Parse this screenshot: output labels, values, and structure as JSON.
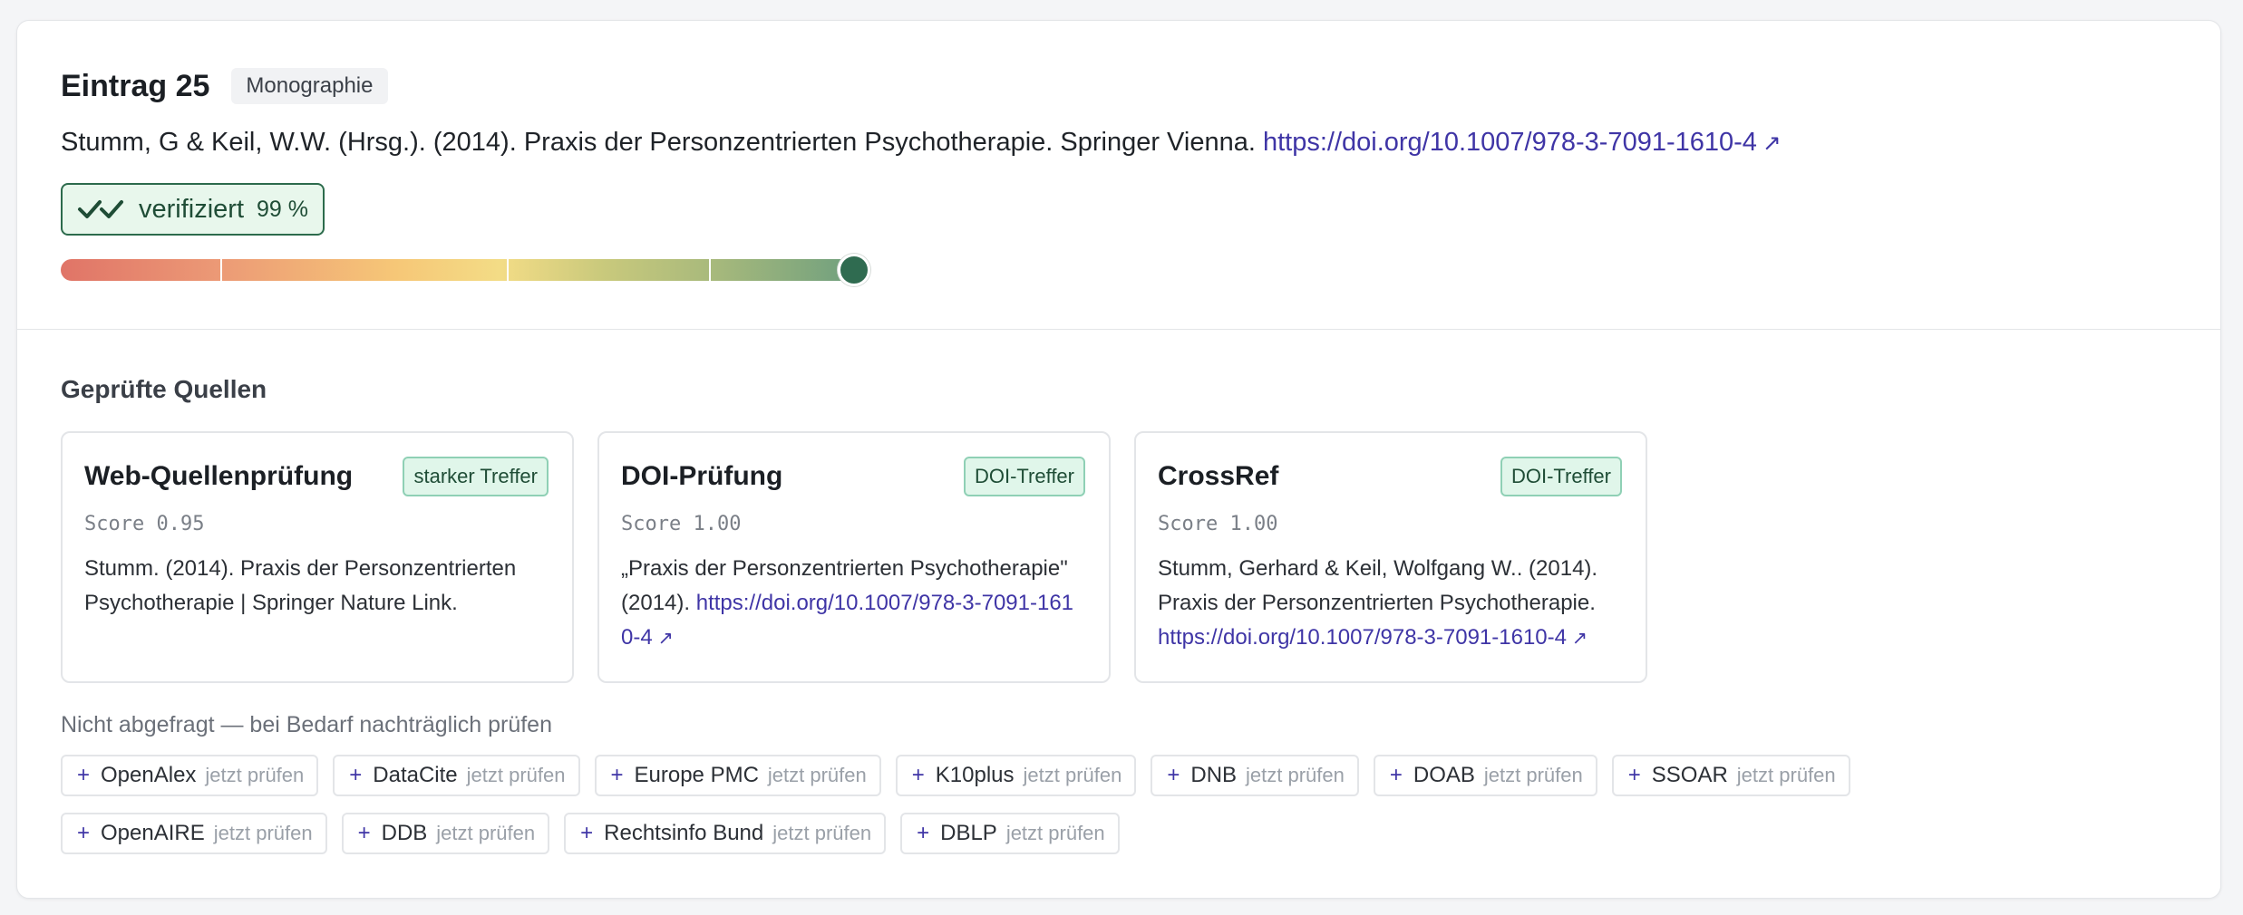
{
  "entry": {
    "title": "Eintrag 25",
    "type_badge": "Monographie",
    "citation_text": "Stumm, G & Keil, W.W. (Hrsg.). (2014). Praxis der Personzentrierten Psychotherapie. Springer Vienna.",
    "citation_link": "https://doi.org/10.1007/978-3-7091-1610-4",
    "status_label": "verifiziert",
    "status_score": "99 %",
    "confidence_percent": 99
  },
  "sources_section": {
    "title": "Geprüfte Quellen",
    "cards": [
      {
        "title": "Web-Quellenprüfung",
        "badge": "starker Treffer",
        "score": "Score 0.95",
        "text": "Stumm. (2014). Praxis der Personzentrierten Psychotherapie | Springer Nature Link.",
        "link": ""
      },
      {
        "title": "DOI-Prüfung",
        "badge": "DOI-Treffer",
        "score": "Score 1.00",
        "text": "„Praxis der Personzentrierten Psychotherapie\" (2014).",
        "link": "https://doi.org/10.1007/978-3-7091-1610-4"
      },
      {
        "title": "CrossRef",
        "badge": "DOI-Treffer",
        "score": "Score 1.00",
        "text": "Stumm, Gerhard & Keil, Wolfgang W.. (2014). Praxis der Personzentrierten Psychotherapie.",
        "link": "https://doi.org/10.1007/978-3-7091-1610-4"
      }
    ]
  },
  "not_queried": {
    "title": "Nicht abgefragt — bei Bedarf nachträglich prüfen",
    "action_label": "jetzt prüfen",
    "plus": "+",
    "chips": [
      "OpenAlex",
      "DataCite",
      "Europe PMC",
      "K10plus",
      "DNB",
      "DOAB",
      "SSOAR",
      "OpenAIRE",
      "DDB",
      "Rechtsinfo Bund",
      "DBLP"
    ]
  },
  "icons": {
    "status": "double-check-icon",
    "external_link": "arrow-up-right-icon",
    "arrow_glyph": "↗"
  },
  "colors": {
    "link": "#3f35a6",
    "verified_border": "#2c6b4c",
    "verified_bg": "#e8f7ec",
    "match_badge_bg": "#e0f6ea",
    "knob": "#2f6b50"
  }
}
